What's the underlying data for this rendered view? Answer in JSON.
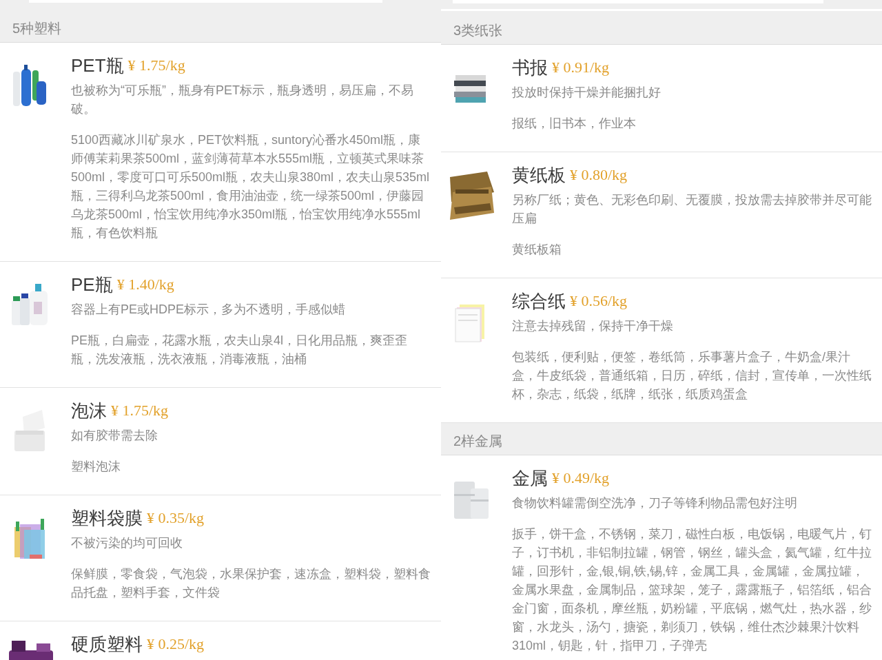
{
  "columns": [
    {
      "sections": [
        {
          "title": "5种塑料",
          "items": [
            {
              "name": "PET瓶",
              "price": "¥ 1.75/kg",
              "description": "也被称为“可乐瓶”，瓶身有PET标示，瓶身透明，易压扁，不易破。",
              "examples": "5100西藏冰川矿泉水，PET饮料瓶，suntory沁番水450ml瓶，康师傅茉莉果茶500ml，蓝剑薄荷草本水555ml瓶，立顿英式果味茶500ml，零度可口可乐500ml瓶，农夫山泉380ml，农夫山泉535ml瓶，三得利乌龙茶500ml，食用油油壶，统一绿茶500ml，伊藤园乌龙茶500ml，怡宝饮用纯净水350ml瓶，怡宝饮用纯净水555ml瓶，有色饮料瓶"
            },
            {
              "name": "PE瓶",
              "price": "¥ 1.40/kg",
              "description": "容器上有PE或HDPE标示，多为不透明，手感似蜡",
              "examples": "PE瓶，白扁壶，花露水瓶，农夫山泉4l，日化用品瓶，爽歪歪瓶，洗发液瓶，洗衣液瓶，消毒液瓶，油桶"
            },
            {
              "name": "泡沫",
              "price": "¥ 1.75/kg",
              "description": "如有胶带需去除",
              "examples": "塑料泡沫"
            },
            {
              "name": "塑料袋膜",
              "price": "¥ 0.35/kg",
              "description": "不被污染的均可回收",
              "examples": "保鲜膜，零食袋，气泡袋，水果保护套，速冻盒，塑料袋，塑料食品托盘，塑料手套，文件袋"
            },
            {
              "name": "硬质塑料",
              "price": "¥ 0.25/kg"
            }
          ]
        }
      ]
    },
    {
      "sections": [
        {
          "title": "3类纸张",
          "items": [
            {
              "name": "书报",
              "price": "¥ 0.91/kg",
              "description": "投放时保持干燥并能捆扎好",
              "examples": "报纸，旧书本，作业本"
            },
            {
              "name": "黄纸板",
              "price": "¥ 0.80/kg",
              "description": "另称厂纸；黄色、无彩色印刷、无覆膜，投放需去掉胶带并尽可能压扁",
              "examples": "黄纸板箱"
            },
            {
              "name": "综合纸",
              "price": "¥ 0.56/kg",
              "description": "注意去掉残留，保持干净干燥",
              "examples": "包装纸，便利贴，便签，卷纸筒，乐事薯片盒子，牛奶盒/果汁盒，牛皮纸袋，普通纸箱，日历，碎纸，信封，宣传单，一次性纸杯，杂志，纸袋，纸牌，纸张，纸质鸡蛋盒"
            }
          ]
        },
        {
          "title": "2样金属",
          "items": [
            {
              "name": "金属",
              "price": "¥ 0.49/kg",
              "description": "食物饮料罐需倒空洗净，刀子等锋利物品需包好注明",
              "examples": "扳手，饼干盒，不锈钢，菜刀，磁性白板，电饭锅，电暖气片，钉子，订书机，非铝制拉罐，钢管，钢丝，罐头盒，氦气罐，红牛拉罐，回形针，金,银,铜,铁,锡,锌，金属工具，金属罐，金属拉罐，金属水果盘，金属制品，篮球架，笼子，露露瓶子，铝箔纸，铝合金门窗，面条机，摩丝瓶，奶粉罐，平底锅，燃气灶，热水器，纱窗，水龙头，汤勺，搪瓷，剃须刀，铁锅，维仕杰沙棘果汁饮料310ml，钥匙，针，指甲刀，子弹壳"
            }
          ]
        }
      ]
    }
  ]
}
